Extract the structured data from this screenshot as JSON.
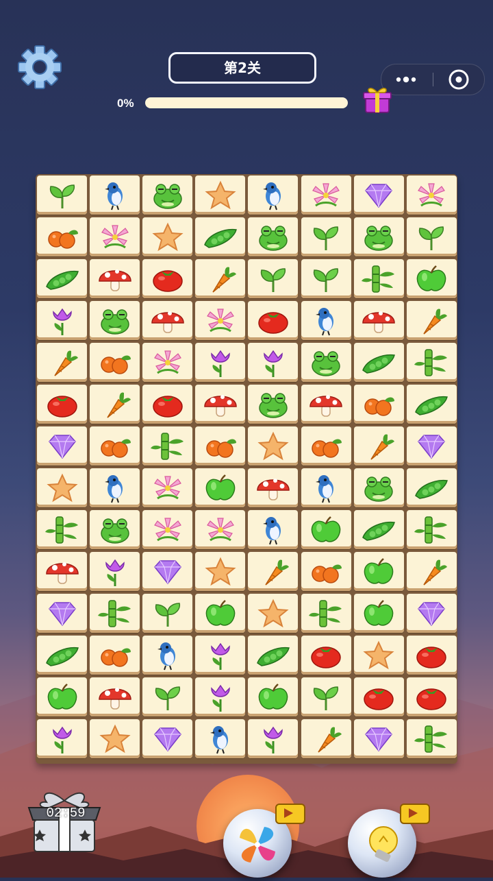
{
  "header": {
    "level_label": "第2关",
    "progress_text": "0%",
    "progress": 0
  },
  "timer": "02:59",
  "icons": {
    "settings": "gear-icon",
    "more": "more-dots-icon",
    "close": "target-close-icon",
    "gift": "gift-icon",
    "chest": "treasure-chest-icon",
    "shuffle": "pinwheel-shuffle-icon",
    "hint": "lightbulb-hint-icon",
    "video": "video-ad-icon"
  },
  "colors": {
    "progress_track": "#fff4d6",
    "tile": "#fcf3d6",
    "board": "#7a5a3c"
  },
  "board": [
    [
      "sprout",
      "bird",
      "frog",
      "star",
      "bird",
      "lily",
      "gem",
      "lily"
    ],
    [
      "orange",
      "lily",
      "star",
      "pea",
      "frog",
      "sprout",
      "frog",
      "sprout"
    ],
    [
      "pea",
      "mushroom",
      "tomato",
      "carrot",
      "sprout",
      "sprout",
      "bamboo",
      "apple"
    ],
    [
      "tulip",
      "frog",
      "mushroom",
      "lily",
      "tomato",
      "bird",
      "mushroom",
      "carrot"
    ],
    [
      "carrot",
      "orange",
      "lily",
      "tulip",
      "tulip",
      "frog",
      "pea",
      "bamboo"
    ],
    [
      "tomato",
      "carrot",
      "tomato",
      "mushroom",
      "frog",
      "mushroom",
      "orange",
      "pea"
    ],
    [
      "gem",
      "orange",
      "bamboo",
      "orange",
      "star",
      "orange",
      "carrot",
      "gem"
    ],
    [
      "star",
      "bird",
      "lily",
      "apple",
      "mushroom",
      "bird",
      "frog",
      "pea"
    ],
    [
      "bamboo",
      "frog",
      "lily",
      "lily",
      "bird",
      "apple",
      "pea",
      "bamboo"
    ],
    [
      "mushroom",
      "tulip",
      "gem",
      "star",
      "carrot",
      "orange",
      "apple",
      "carrot"
    ],
    [
      "gem",
      "bamboo",
      "sprout",
      "apple",
      "star",
      "bamboo",
      "apple",
      "gem"
    ],
    [
      "pea",
      "orange",
      "bird",
      "tulip",
      "pea",
      "tomato",
      "star",
      "tomato"
    ],
    [
      "apple",
      "mushroom",
      "sprout",
      "tulip",
      "apple",
      "sprout",
      "tomato",
      "tomato"
    ],
    [
      "tulip",
      "star",
      "gem",
      "bird",
      "tulip",
      "carrot",
      "gem",
      "bamboo"
    ]
  ]
}
